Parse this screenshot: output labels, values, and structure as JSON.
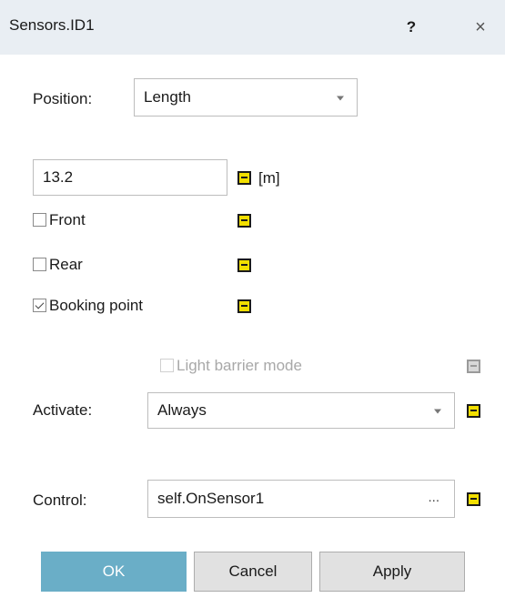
{
  "window": {
    "title": "Sensors.ID1",
    "help_label": "?",
    "close_label": "×"
  },
  "position": {
    "label": "Position:",
    "selected": "Length"
  },
  "length": {
    "value": "13.2",
    "unit": "[m]"
  },
  "checkboxes": {
    "front": {
      "label": "Front",
      "checked": false
    },
    "rear": {
      "label": "Rear",
      "checked": false
    },
    "booking_point": {
      "label": "Booking point",
      "checked": true
    },
    "light_barrier": {
      "label": "Light barrier mode",
      "checked": false,
      "enabled": false
    }
  },
  "activate": {
    "label": "Activate:",
    "selected": "Always"
  },
  "control": {
    "label": "Control:",
    "value": "self.OnSensor1",
    "browse_label": "..."
  },
  "buttons": {
    "ok": "OK",
    "cancel": "Cancel",
    "apply": "Apply"
  },
  "colors": {
    "title_bar": "#e9eef3",
    "formula_icon": "#f2df00",
    "ok_button": "#6aaec7"
  },
  "icons": {
    "formula": "formula-icon",
    "dropdown": "chevron-down-icon",
    "check": "checkmark-icon"
  }
}
